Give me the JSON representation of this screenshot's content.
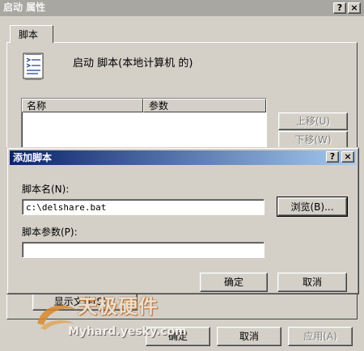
{
  "outer": {
    "title": "启动 属性",
    "help_glyph": "?",
    "close_glyph": "×",
    "tab_label": "脚本",
    "header_text": "启动 脚本(本地计算机 的)",
    "columns": [
      "名称",
      "参数"
    ],
    "move_up": "上移(U)",
    "move_down": "下移(W)",
    "show_files": "显示文件(S)...",
    "ok": "确定",
    "cancel": "取消",
    "apply": "应用(A)"
  },
  "dialog": {
    "title": "添加脚本",
    "help_glyph": "?",
    "close_glyph": "×",
    "script_name_label": "脚本名(N):",
    "script_name_value": "c:\\delshare.bat",
    "browse": "浏览(B)...",
    "script_params_label": "脚本参数(P):",
    "script_params_value": "",
    "ok": "确定",
    "cancel": "取消"
  },
  "watermark": {
    "text": "天极硬件",
    "url": "Myhard.yesky.com"
  },
  "colors": {
    "face": "#d4d0c8",
    "title_active_start": "#0a246a",
    "title_active_end": "#a6caf0",
    "title_inactive": "#a9a7a2"
  }
}
